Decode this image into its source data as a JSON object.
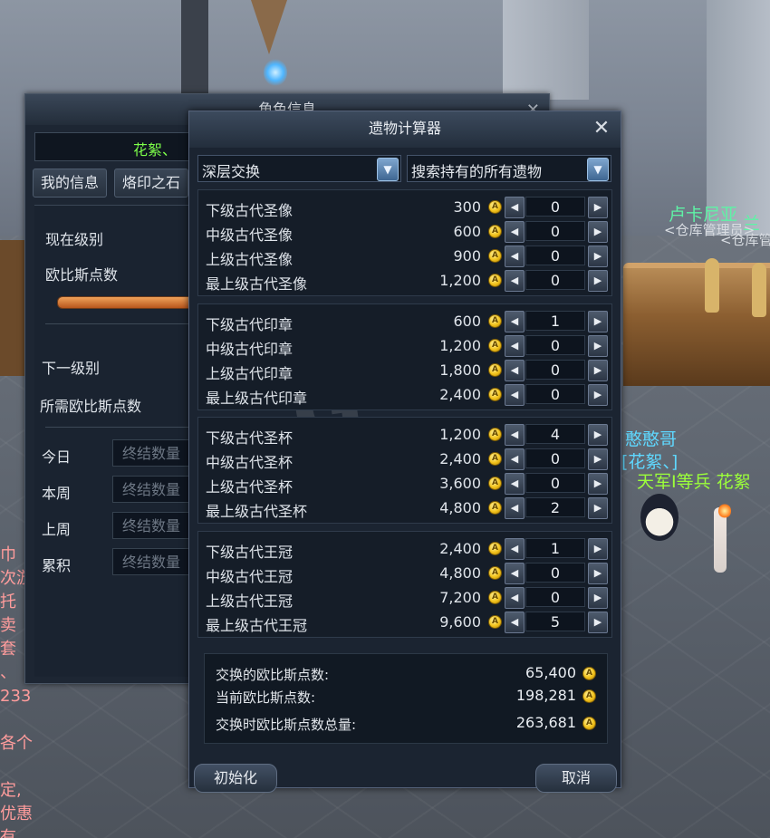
{
  "scene": {
    "npc_name_1": "卢卡尼亚",
    "npc_title_1": "<仓库管理员>",
    "npc_name_2": "兰",
    "npc_title_2": "<仓库管",
    "player_name": "憨憨哥",
    "player_legion": "[花絮、]",
    "player2_title": "天军I等兵 花絮",
    "left_chat": "巾\n次游\n托\n卖\n套\n、\n233\n\n各个\n\n定,\n优惠\n有"
  },
  "character_window": {
    "title": "角色信息",
    "name": "花絮、",
    "tabs": [
      "我的信息",
      "烙印之石"
    ],
    "labels": {
      "current_level": "现在级别",
      "abyss_points": "欧比斯点数",
      "next_level": "下一级别",
      "required_points": "所需欧比斯点数",
      "today": "今日",
      "this_week": "本周",
      "last_week": "上周",
      "total": "累积"
    },
    "kill_count_placeholder": "终结数量"
  },
  "relic_calculator": {
    "title": "遗物计算器",
    "dropdown_type": "深层交换",
    "dropdown_filter": "搜索持有的所有遗物",
    "groups": [
      {
        "items": [
          {
            "name": "下级古代圣像",
            "price": "300",
            "qty": "0"
          },
          {
            "name": "中级古代圣像",
            "price": "600",
            "qty": "0"
          },
          {
            "name": "上级古代圣像",
            "price": "900",
            "qty": "0"
          },
          {
            "name": "最上级古代圣像",
            "price": "1,200",
            "qty": "0"
          }
        ]
      },
      {
        "items": [
          {
            "name": "下级古代印章",
            "price": "600",
            "qty": "1"
          },
          {
            "name": "中级古代印章",
            "price": "1,200",
            "qty": "0"
          },
          {
            "name": "上级古代印章",
            "price": "1,800",
            "qty": "0"
          },
          {
            "name": "最上级古代印章",
            "price": "2,400",
            "qty": "0"
          }
        ]
      },
      {
        "items": [
          {
            "name": "下级古代圣杯",
            "price": "1,200",
            "qty": "4"
          },
          {
            "name": "中级古代圣杯",
            "price": "2,400",
            "qty": "0"
          },
          {
            "name": "上级古代圣杯",
            "price": "3,600",
            "qty": "0"
          },
          {
            "name": "最上级古代圣杯",
            "price": "4,800",
            "qty": "2"
          }
        ]
      },
      {
        "items": [
          {
            "name": "下级古代王冠",
            "price": "2,400",
            "qty": "1"
          },
          {
            "name": "中级古代王冠",
            "price": "4,800",
            "qty": "0"
          },
          {
            "name": "上级古代王冠",
            "price": "7,200",
            "qty": "0"
          },
          {
            "name": "最上级古代王冠",
            "price": "9,600",
            "qty": "5"
          }
        ]
      }
    ],
    "summary": {
      "exchange_label": "交换的欧比斯点数:",
      "exchange_value": "65,400",
      "current_label": "当前欧比斯点数:",
      "current_value": "198,281",
      "total_label": "交换时欧比斯点数总量:",
      "total_value": "263,681"
    },
    "reset_label": "初始化",
    "cancel_label": "取消",
    "coin_icon": "abyss-point-coin-icon",
    "accent_color": "#f2c21a"
  }
}
